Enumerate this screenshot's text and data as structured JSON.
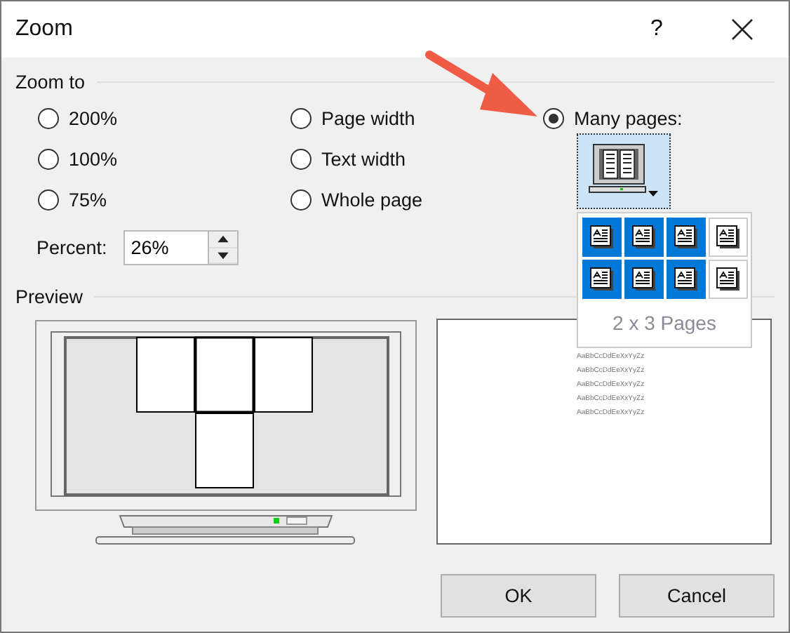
{
  "window": {
    "title": "Zoom",
    "help": "?"
  },
  "zoom_to": {
    "label": "Zoom to",
    "options": [
      {
        "label": "200%",
        "selected": false
      },
      {
        "label": "100%",
        "selected": false
      },
      {
        "label": "75%",
        "selected": false
      },
      {
        "label": "Page width",
        "selected": false
      },
      {
        "label": "Text width",
        "selected": false
      },
      {
        "label": "Whole page",
        "selected": false
      },
      {
        "label": "Many pages:",
        "selected": true
      }
    ]
  },
  "pages_picker": {
    "expanded": true,
    "label": "2 x 3 Pages",
    "cells": [
      {
        "selected": true
      },
      {
        "selected": true
      },
      {
        "selected": true
      },
      {
        "selected": false
      },
      {
        "selected": true
      },
      {
        "selected": true
      },
      {
        "selected": true
      },
      {
        "selected": false
      }
    ]
  },
  "percent": {
    "label": "Percent:",
    "value": "26%"
  },
  "preview": {
    "label": "Preview",
    "sample_lines": [
      "AaBbCcDdEeXxYyZz",
      "AaBbCcDdEeXxYyZz",
      "AaBbCcDdEeXxYyZz",
      "AaBbCcDdEeXxYyZz",
      "AaBbCcDdEeXxYyZz"
    ]
  },
  "buttons": [
    {
      "label": "OK"
    },
    {
      "label": "Cancel"
    }
  ]
}
